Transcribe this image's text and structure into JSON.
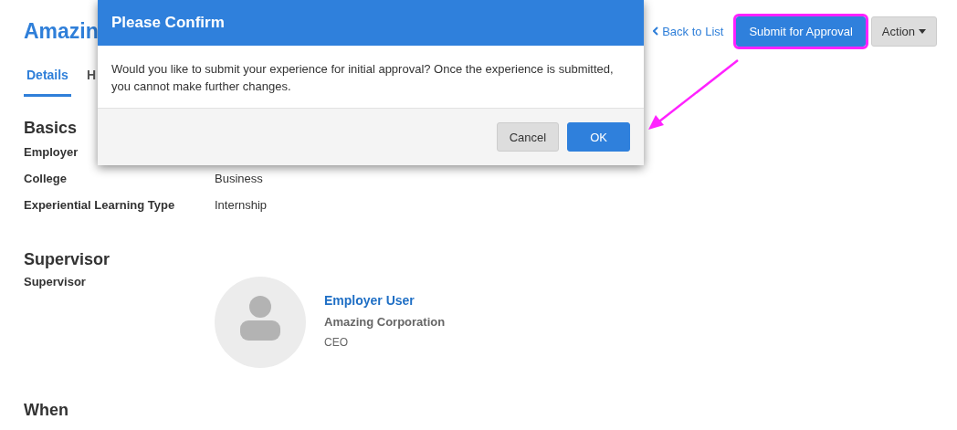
{
  "page": {
    "title": "Amazin",
    "back_link": "Back to List",
    "submit_button": {
      "label": "Submit for Approval",
      "highlighted": true
    },
    "action_button": "Action",
    "tabs": [
      {
        "label": "Details",
        "selected": true
      },
      {
        "label": "H",
        "selected": false
      }
    ],
    "sections": [
      {
        "heading": "Basics",
        "rows": [
          {
            "label": "Employer"
          },
          {
            "label": "College",
            "value": "Business"
          },
          {
            "label": "Experiential Learning Type",
            "value": "Internship"
          }
        ]
      },
      {
        "heading": "Supervisor",
        "label": "Supervisor",
        "person": {
          "name": "Employer User",
          "company": "Amazing Corporation",
          "role": "CEO"
        }
      },
      {
        "heading": "When"
      }
    ]
  },
  "dialog": {
    "title": "Please Confirm",
    "message": "Would you like to submit your experience for initial approval? Once the experience is submitted, you cannot make further changes.",
    "buttons": [
      {
        "label": "Cancel",
        "kind": "secondary"
      },
      {
        "label": "OK",
        "kind": "primary"
      }
    ]
  }
}
